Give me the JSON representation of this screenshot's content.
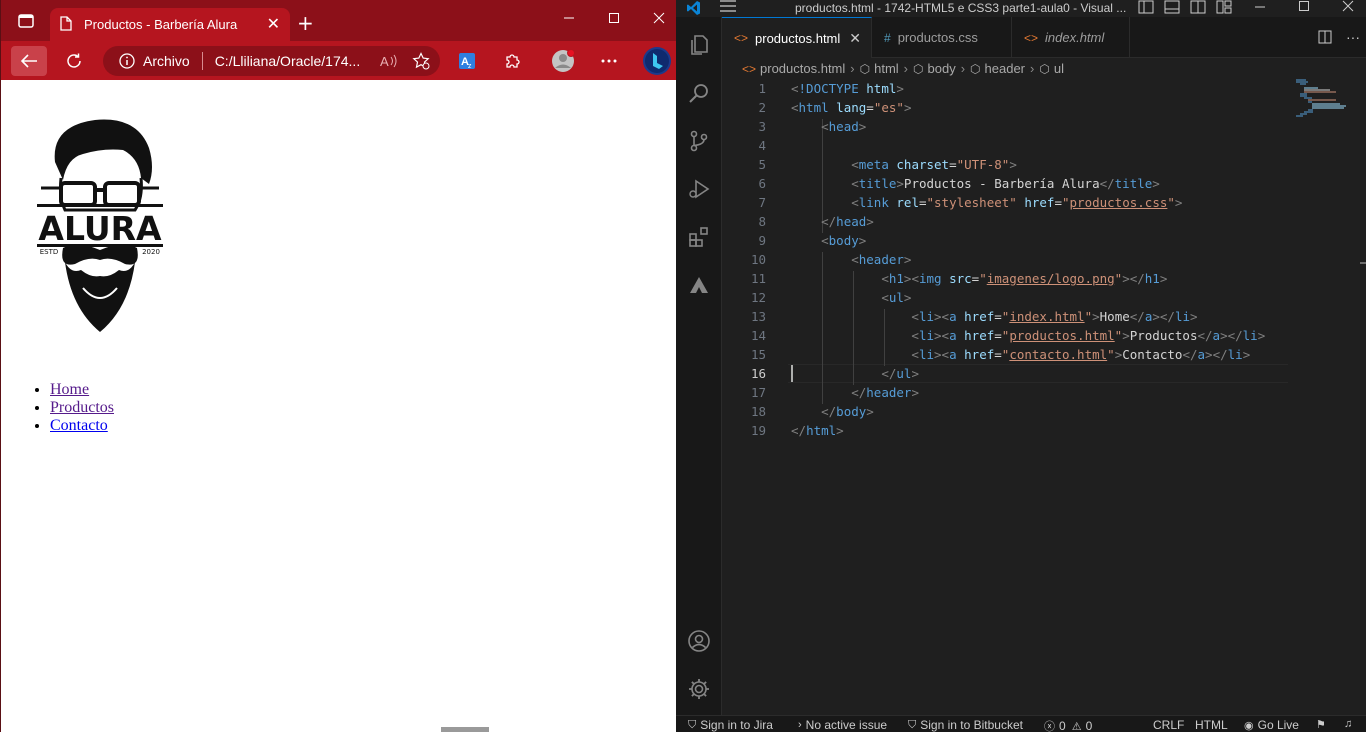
{
  "browser": {
    "tab_title": "Productos - Barbería Alura",
    "tab_close": "✕",
    "new_tab": "+",
    "site_info_label": "Archivo",
    "address": "C:/Lliliana/Oracle/174...",
    "page": {
      "logo": {
        "brand": "ALURA",
        "left_text": "ESTD",
        "right_text": "2020"
      },
      "nav_items": [
        {
          "label": "Home"
        },
        {
          "label": "Productos"
        },
        {
          "label": "Contacto"
        }
      ]
    }
  },
  "vscode": {
    "window_title": "productos.html - 1742-HTML5 e CSS3 parte1-aula0 - Visual ...",
    "tabs": [
      {
        "label": "productos.html",
        "icon": "<>",
        "active": true,
        "close": "✕"
      },
      {
        "label": "productos.css",
        "icon": "#"
      },
      {
        "label": "index.html",
        "icon": "<>"
      }
    ],
    "breadcrumb": [
      "productos.html",
      "html",
      "body",
      "header",
      "ul"
    ],
    "code_lines": [
      "<!DOCTYPE html>",
      "<html lang=\"es\">",
      "    <head>",
      "",
      "        <meta charset=\"UTF-8\">",
      "        <title>Productos - Barbería Alura</title>",
      "        <link rel=\"stylesheet\" href=\"productos.css\">",
      "    </head>",
      "    <body>",
      "        <header>",
      "            <h1><img src=\"imagenes/logo.png\"></h1>",
      "            <ul>",
      "                <li><a href=\"index.html\">Home</a></li>",
      "                <li><a href=\"productos.html\">Productos</a></li>",
      "                <li><a href=\"contacto.html\">Contacto</a></li>",
      "            </ul>",
      "        </header>",
      "    </body>",
      "</html>"
    ],
    "current_line": 16,
    "status": {
      "jira": "Sign in to Jira",
      "issue": "No active issue",
      "bitbucket": "Sign in to Bitbucket",
      "problems": "0",
      "warnings": "0",
      "eol": "CRLF",
      "language": "HTML",
      "golive": "Go Live"
    }
  },
  "colors": {
    "browser_tabbar": "#8c1019",
    "browser_toolbar": "#b5151f",
    "vscode_bg": "#1f1f1f",
    "accent": "#0078d4"
  }
}
